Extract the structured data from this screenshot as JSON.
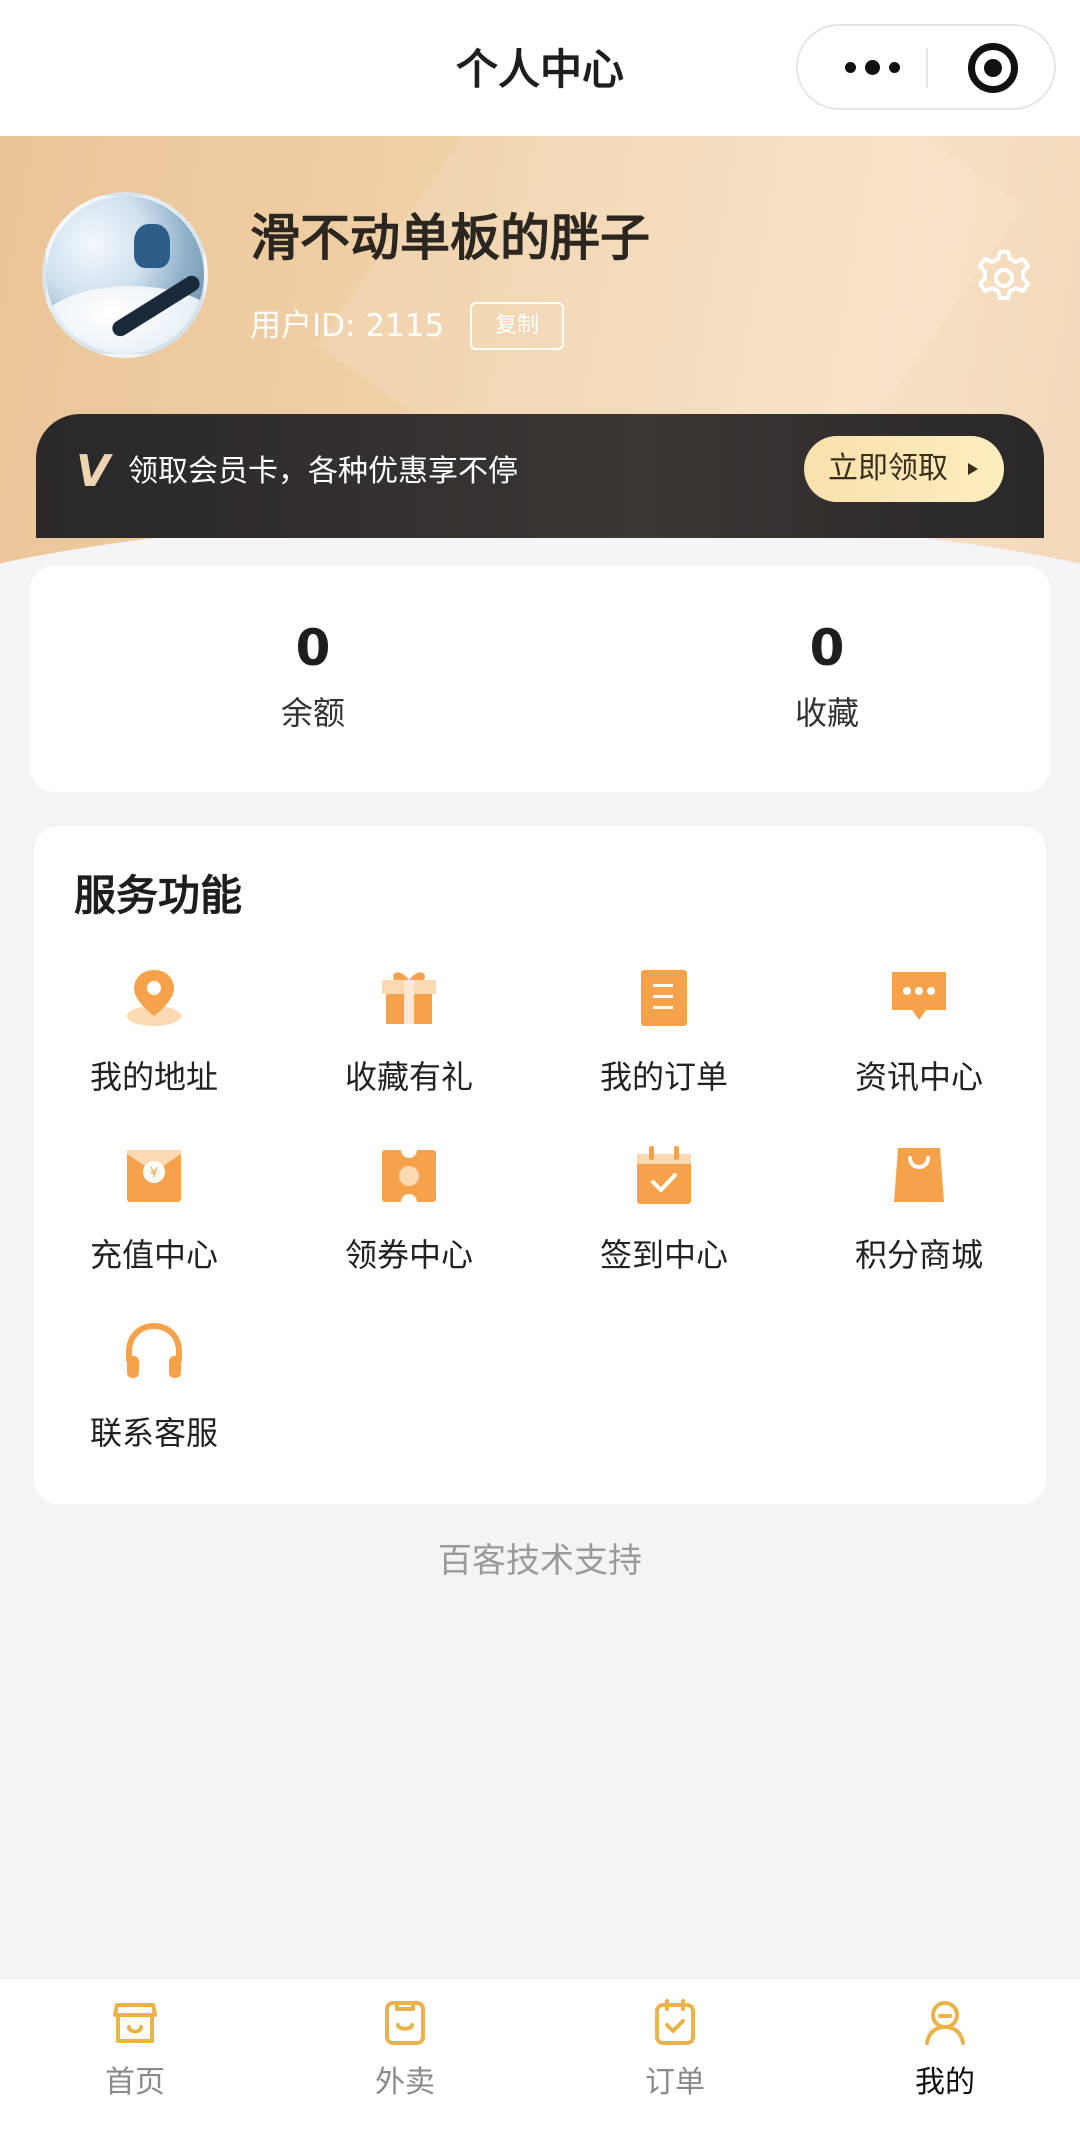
{
  "titlebar": {
    "title": "个人中心"
  },
  "profile": {
    "username": "滑不动单板的胖子",
    "user_id": "用户ID: 2115",
    "copy_label": "复制"
  },
  "member": {
    "logo": "V",
    "text": "领取会员卡，各种优惠享不停",
    "claim_label": "立即领取"
  },
  "stats": [
    {
      "value": "0",
      "label": "余额"
    },
    {
      "value": "0",
      "label": "收藏"
    }
  ],
  "services": {
    "heading": "服务功能",
    "items": [
      {
        "label": "我的地址",
        "icon": "location-pin-icon"
      },
      {
        "label": "收藏有礼",
        "icon": "gift-icon"
      },
      {
        "label": "我的订单",
        "icon": "order-list-icon"
      },
      {
        "label": "资讯中心",
        "icon": "message-bubble-icon"
      },
      {
        "label": "充值中心",
        "icon": "recharge-envelope-icon"
      },
      {
        "label": "领券中心",
        "icon": "coupon-icon"
      },
      {
        "label": "签到中心",
        "icon": "calendar-check-icon"
      },
      {
        "label": "积分商城",
        "icon": "shopping-bag-icon"
      },
      {
        "label": "联系客服",
        "icon": "headset-icon"
      }
    ]
  },
  "footer": {
    "support_text": "百客技术支持"
  },
  "tabbar": {
    "items": [
      {
        "label": "首页",
        "icon": "home-store-icon",
        "active": false
      },
      {
        "label": "外卖",
        "icon": "takeout-icon",
        "active": false
      },
      {
        "label": "订单",
        "icon": "order-icon",
        "active": false
      },
      {
        "label": "我的",
        "icon": "profile-icon",
        "active": true
      }
    ]
  },
  "colors": {
    "accent_orange": "#f6a24b",
    "tab_gold": "#e9b24a",
    "banner_gold": "#efcda3",
    "member_dark": "#2f2d2c"
  }
}
